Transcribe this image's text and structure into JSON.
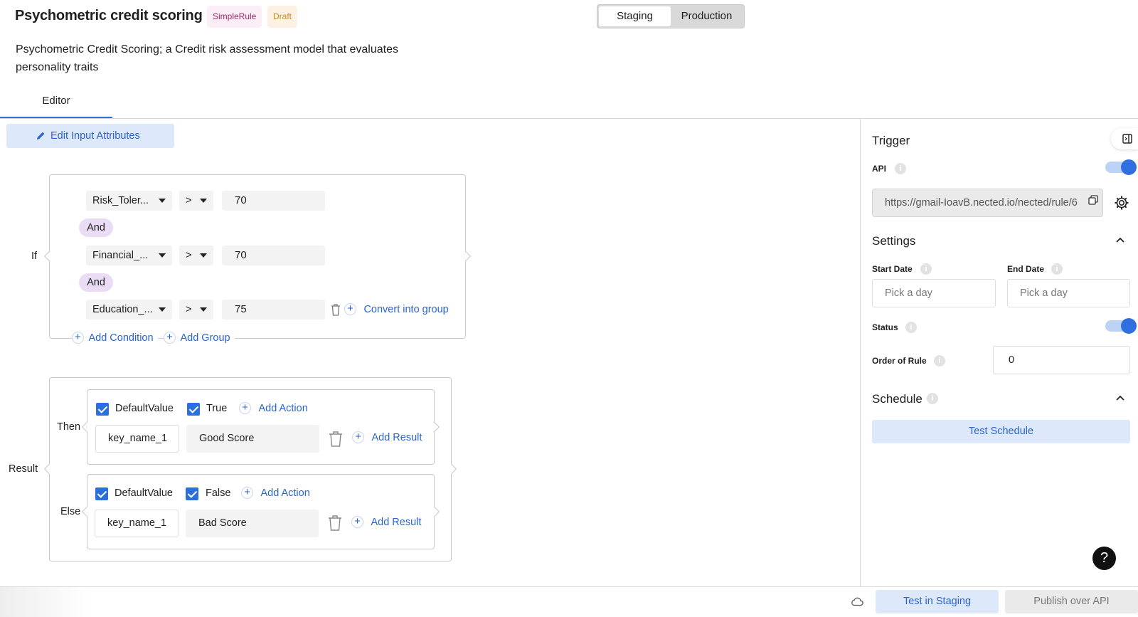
{
  "header": {
    "title": "Psychometric credit scoring",
    "badge_type": "SimpleRule",
    "badge_status": "Draft",
    "env_staging": "Staging",
    "env_production": "Production",
    "description": "Psychometric Credit Scoring; a Credit risk assessment model that evaluates personality traits",
    "tab_editor": "Editor"
  },
  "editor": {
    "edit_input_label": "Edit Input Attributes",
    "if_label": "If",
    "conditions": [
      {
        "attribute": "Risk_Toler...",
        "operator": ">",
        "value": "70"
      },
      {
        "attribute": "Financial_...",
        "operator": ">",
        "value": "70"
      },
      {
        "attribute": "Education_...",
        "operator": ">",
        "value": "75"
      }
    ],
    "and_label": "And",
    "convert_group": "Convert into group",
    "add_condition": "Add Condition",
    "add_group": "Add Group",
    "result_label": "Result",
    "then": {
      "label": "Then",
      "default_value": "DefaultValue",
      "flag": "True",
      "add_action": "Add Action",
      "key": "key_name_1",
      "result": "Good Score",
      "add_result": "Add Result"
    },
    "else": {
      "label": "Else",
      "default_value": "DefaultValue",
      "flag": "False",
      "add_action": "Add Action",
      "key": "key_name_1",
      "result": "Bad Score",
      "add_result": "Add Result"
    }
  },
  "sidebar": {
    "trigger": "Trigger",
    "api_label": "API",
    "api_url": "https://gmail-IoavB.nected.io/nected/rule/6",
    "settings": "Settings",
    "start_date_label": "Start Date",
    "end_date_label": "End Date",
    "date_placeholder": "Pick a day",
    "status_label": "Status",
    "order_label": "Order of Rule",
    "order_value": "0",
    "schedule": "Schedule",
    "test_schedule": "Test Schedule"
  },
  "footer": {
    "test_staging": "Test in Staging",
    "publish": "Publish over API",
    "help": "?"
  },
  "colors": {
    "accent": "#2f6fe0",
    "and_pill": "#eadcf4"
  }
}
